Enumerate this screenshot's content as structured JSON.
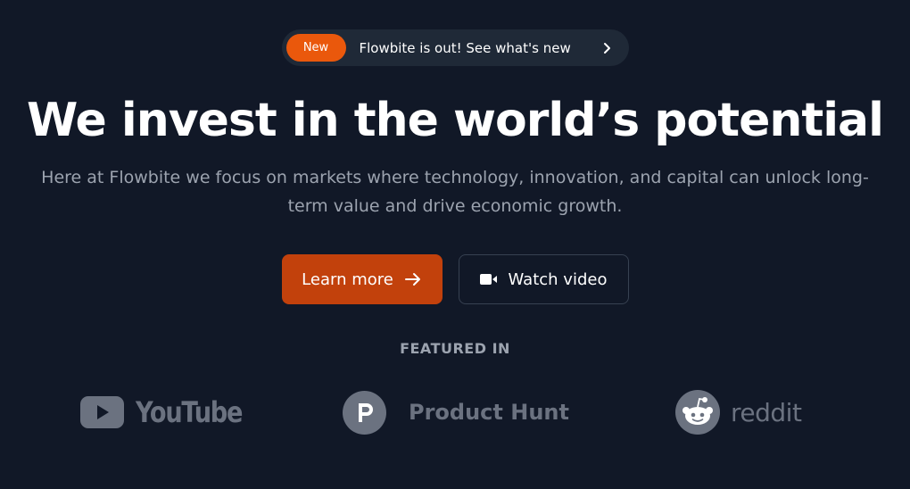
{
  "announcement": {
    "badge": "New",
    "text": "Flowbite is out! See what's new"
  },
  "hero": {
    "headline": "We invest in the world’s potential",
    "subtext": "Here at Flowbite we focus on markets where technology, innovation, and capital can unlock long-term value and drive economic growth."
  },
  "buttons": {
    "learn_more": "Learn more",
    "watch_video": "Watch video"
  },
  "featured": {
    "heading": "FEATURED IN",
    "logos": [
      {
        "name": "YouTube",
        "icon": "youtube-icon"
      },
      {
        "name": "Product Hunt",
        "icon": "product-hunt-icon"
      },
      {
        "name": "reddit",
        "icon": "reddit-icon"
      }
    ]
  },
  "colors": {
    "background": "#111827",
    "accent": "#ea580c",
    "primary_button": "#c2410c",
    "muted_text": "#9ca3af",
    "logo_gray": "#6b7280"
  }
}
